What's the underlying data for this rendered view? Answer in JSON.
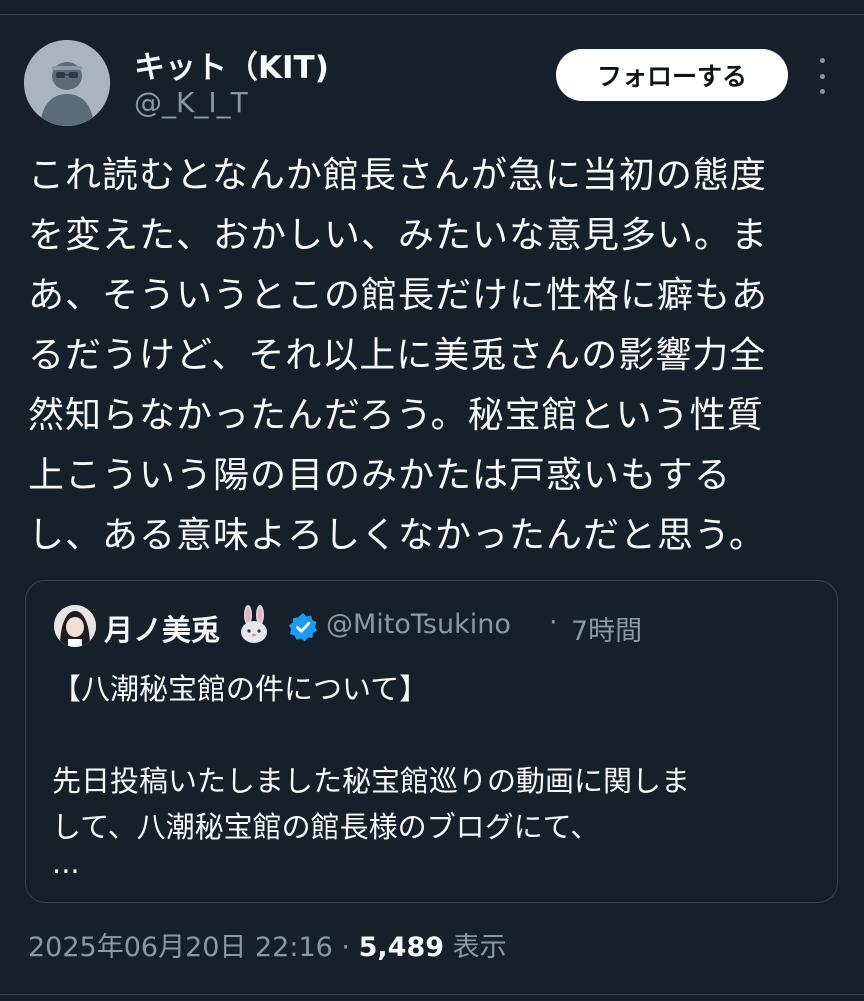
{
  "author": {
    "display_name": "キット（KIT)",
    "handle": "@_K_I_T"
  },
  "follow_button": {
    "label": "フォローする"
  },
  "more_icon": "more-vertical-icon",
  "tweet": {
    "lines": [
      "これ読むとなんか館長さんが急に当初の態度",
      "を変えた、おかしい、みたいな意見多い。ま",
      "あ、そういうとこの館長だけに性格に癖もあ",
      "るだうけど、それ以上に美兎さんの影響力全",
      "然知らなかったんだろう。秘宝館という性質",
      "上こういう陽の目のみかたは戸惑いもする",
      "し、ある意味よろしくなかったんだと思う。"
    ]
  },
  "quote": {
    "display_name": "月ノ美兎",
    "emoji": "🐰",
    "verified_icon": "verified-badge-icon",
    "handle": "@MitoTsukino",
    "separator": "·",
    "time": "7時間",
    "lines": [
      "【八潮秘宝館の件について】",
      "",
      "先日投稿いたしました秘宝館巡りの動画に関しま",
      "して、八潮秘宝館の館長様のブログにて、",
      "..."
    ]
  },
  "meta": {
    "datetime": "2025年06月20日 22:16",
    "separator": "·",
    "views_count": "5,489",
    "views_label": "表示"
  },
  "colors": {
    "background": "#15202b",
    "text_primary": "#f7f9f9",
    "text_secondary": "#8b98a5",
    "border": "#38444d",
    "verified": "#1d9bf0"
  }
}
